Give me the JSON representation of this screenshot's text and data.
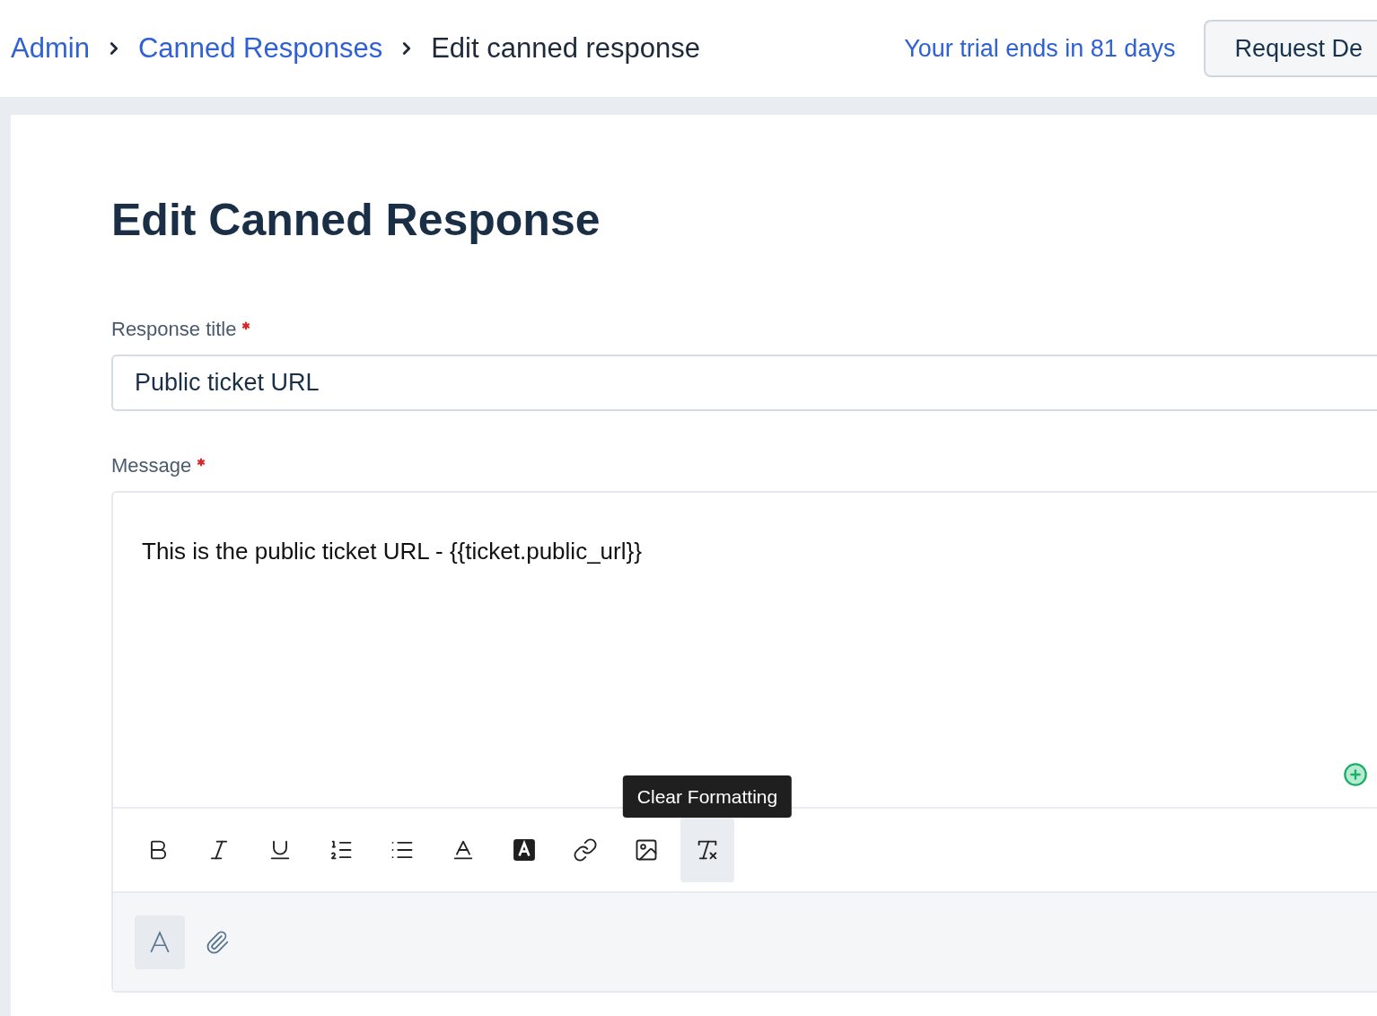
{
  "breadcrumbs": [
    {
      "label": "Admin",
      "kind": "link"
    },
    {
      "label": "Canned Responses",
      "kind": "link"
    },
    {
      "label": "Edit canned response",
      "kind": "current"
    }
  ],
  "trial": "Your trial ends in 81 days",
  "request_button": "Request De",
  "heading": "Edit Canned Response",
  "title_field": {
    "label": "Response title",
    "required": true,
    "value": "Public ticket URL"
  },
  "message_field": {
    "label": "Message",
    "required": true,
    "value": "This is the public ticket URL - {{ticket.public_url}}"
  },
  "toolbar": [
    {
      "kind": "bold",
      "hovered": false
    },
    {
      "kind": "italic",
      "hovered": false
    },
    {
      "kind": "underline",
      "hovered": false
    },
    {
      "kind": "ordered",
      "hovered": false
    },
    {
      "kind": "bullets",
      "hovered": false
    },
    {
      "kind": "textcolor",
      "hovered": false
    },
    {
      "kind": "highlight",
      "hovered": false
    },
    {
      "kind": "link",
      "hovered": false
    },
    {
      "kind": "image",
      "hovered": false
    },
    {
      "kind": "clear",
      "hovered": true,
      "tooltip": "Clear Formatting"
    }
  ],
  "footer_tools": [
    {
      "kind": "format",
      "selected": true
    },
    {
      "kind": "attach",
      "selected": false
    }
  ]
}
